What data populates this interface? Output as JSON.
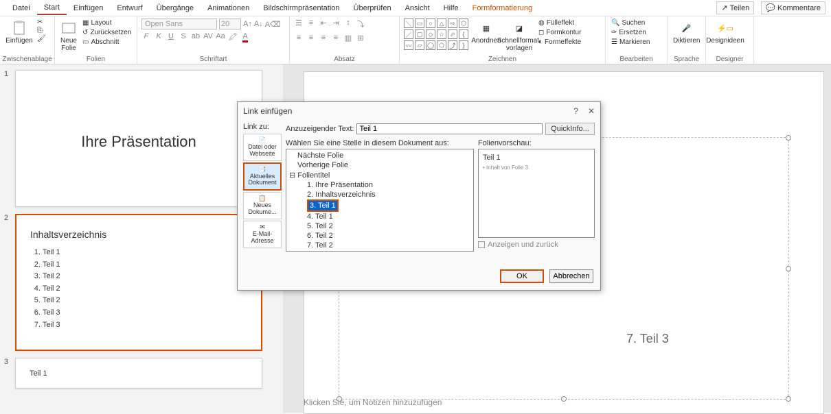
{
  "menu": {
    "tabs": [
      "Datei",
      "Start",
      "Einfügen",
      "Entwurf",
      "Übergänge",
      "Animationen",
      "Bildschirmpräsentation",
      "Überprüfen",
      "Ansicht",
      "Hilfe",
      "Formformatierung"
    ],
    "active_index": 1,
    "orange_index": 10,
    "share": "Teilen",
    "comments": "Kommentare"
  },
  "ribbon": {
    "clipboard": {
      "label": "Zwischenablage",
      "paste": "Einfügen"
    },
    "slides": {
      "label": "Folien",
      "new_slide": "Neue\nFolie",
      "opts": [
        "Layout",
        "Zurücksetzen",
        "Abschnitt"
      ]
    },
    "font": {
      "label": "Schriftart",
      "name": "Open Sans",
      "size": "20"
    },
    "paragraph": {
      "label": "Absatz"
    },
    "drawing": {
      "label": "Zeichnen",
      "arrange": "Anordnen",
      "quickstyles": "Schnellformat-\nvorlagen",
      "fill": "Fülleffekt",
      "outline": "Formkontur",
      "effects": "Formeffekte"
    },
    "editing": {
      "label": "Bearbeiten",
      "find": "Suchen",
      "replace": "Ersetzen",
      "select": "Markieren"
    },
    "voice": {
      "label": "Sprache",
      "dictate": "Diktieren"
    },
    "designer": {
      "label": "Designer",
      "ideas": "Designideen"
    }
  },
  "thumbs": {
    "s1": {
      "num": "1",
      "title": "Ihre Präsentation"
    },
    "s2": {
      "num": "2",
      "title": "Inhaltsverzeichnis",
      "items": [
        "Teil 1",
        "Teil 1",
        "Teil 2",
        "Teil 2",
        "Teil 2",
        "Teil 3",
        "Teil 3"
      ]
    },
    "s3": {
      "num": "3",
      "title": "Teil 1"
    }
  },
  "editor": {
    "line7": "7. Teil 3",
    "notes": "Klicken Sie, um Notizen hinzuzufügen"
  },
  "dialog": {
    "title": "Link einfügen",
    "link_to": "Link zu:",
    "opts": [
      "Datei oder Webseite",
      "Aktuelles Dokument",
      "Neues Dokume...",
      "E-Mail-Adresse"
    ],
    "display_label": "Anzuzeigender Text:",
    "display_value": "Teil 1",
    "quickinfo": "QuickInfo...",
    "select_label": "Wählen Sie eine Stelle in diesem Dokument aus:",
    "tree": {
      "next": "Nächste Folie",
      "prev": "Vorherige Folie",
      "titles": "Folientitel",
      "items": [
        "1. Ihre Präsentation",
        "2. Inhaltsverzeichnis",
        "3. Teil 1",
        "4. Teil 1",
        "5. Teil 2",
        "6. Teil 2",
        "7. Teil 2"
      ]
    },
    "preview_label": "Folienvorschau:",
    "preview": {
      "title": "Teil 1",
      "content": "• Inhalt von Folie 3"
    },
    "show_return": "Anzeigen und zurück",
    "ok": "OK",
    "cancel": "Abbrechen"
  }
}
